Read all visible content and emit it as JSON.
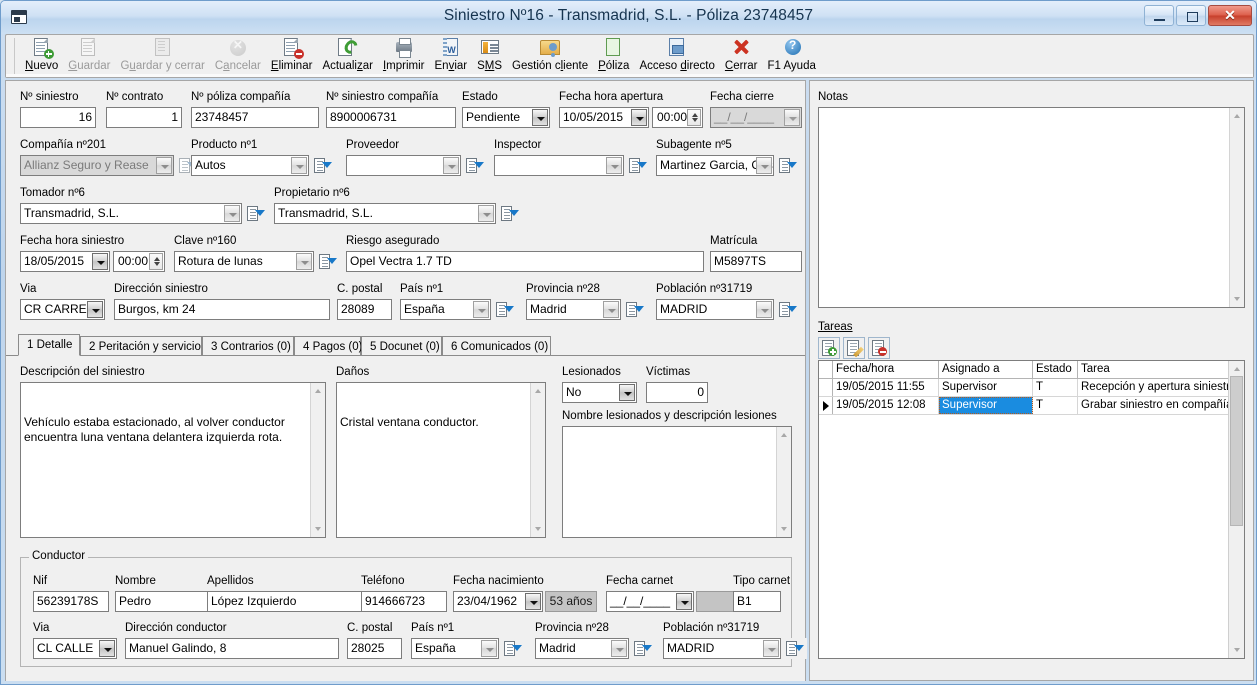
{
  "window": {
    "title": "Siniestro Nº16 - Transmadrid, S.L. - Póliza 23748457",
    "minimize_label": "",
    "maximize_label": "",
    "close_label": ""
  },
  "toolbar": [
    {
      "name": "nuevo",
      "label": "Nuevo",
      "icon": "new-document-icon",
      "disabled": false
    },
    {
      "name": "guardar",
      "label": "Guardar",
      "icon": "save-icon",
      "disabled": true
    },
    {
      "name": "guardar-cerrar",
      "label": "Guardar y cerrar",
      "icon": "save-and-close-icon",
      "disabled": true
    },
    {
      "name": "cancelar",
      "label": "Cancelar",
      "icon": "cancel-icon",
      "disabled": true
    },
    {
      "name": "eliminar",
      "label": "Eliminar",
      "icon": "delete-document-icon",
      "disabled": false
    },
    {
      "name": "actualizar",
      "label": "Actualizar",
      "icon": "refresh-icon",
      "disabled": false
    },
    {
      "name": "imprimir",
      "label": "Imprimir",
      "icon": "printer-icon",
      "disabled": false
    },
    {
      "name": "enviar",
      "label": "Enviar",
      "icon": "word-document-icon",
      "disabled": false
    },
    {
      "name": "sms",
      "label": "SMS",
      "icon": "sms-icon",
      "disabled": false
    },
    {
      "name": "gestion-cliente",
      "label": "Gestión cliente",
      "icon": "client-card-icon",
      "disabled": false
    },
    {
      "name": "poliza",
      "label": "Póliza",
      "icon": "policy-document-icon",
      "disabled": false
    },
    {
      "name": "acceso-directo",
      "label": "Acceso directo",
      "icon": "shortcut-icon",
      "disabled": false
    },
    {
      "name": "cerrar",
      "label": "Cerrar",
      "icon": "red-x-icon",
      "disabled": false
    },
    {
      "name": "ayuda",
      "label": "F1 Ayuda",
      "icon": "help-icon",
      "disabled": false
    }
  ],
  "form": {
    "n_siniestro": {
      "label": "Nº siniestro",
      "value": "16"
    },
    "n_contrato": {
      "label": "Nº contrato",
      "value": "1"
    },
    "n_poliza_compania": {
      "label": "Nº póliza compañía",
      "value": "23748457"
    },
    "n_siniestro_compania": {
      "label": "Nº siniestro compañía",
      "value": "8900006731"
    },
    "estado": {
      "label": "Estado",
      "value": "Pendiente"
    },
    "fecha_hora_apertura": {
      "label": "Fecha hora apertura",
      "value": "10/05/2015",
      "time": "00:00"
    },
    "fecha_cierre": {
      "label": "Fecha cierre",
      "value": "__/__/____"
    },
    "compania": {
      "label": "Compañía nº201",
      "value": "Allianz Seguro y Rease"
    },
    "producto": {
      "label": "Producto nº1",
      "value": "Autos"
    },
    "proveedor": {
      "label": "Proveedor",
      "value": ""
    },
    "inspector": {
      "label": "Inspector",
      "value": ""
    },
    "subagente": {
      "label": "Subagente nº5",
      "value": "Martinez Garcia, Cris"
    },
    "tomador": {
      "label": "Tomador nº6",
      "value": "Transmadrid, S.L."
    },
    "propietario": {
      "label": "Propietario nº6",
      "value": "Transmadrid, S.L."
    },
    "fecha_hora_siniestro": {
      "label": "Fecha hora siniestro",
      "value": "18/05/2015",
      "time": "00:00"
    },
    "clave": {
      "label": "Clave nº160",
      "value": "Rotura de lunas"
    },
    "riesgo_asegurado": {
      "label": "Riesgo asegurado",
      "value": "Opel Vectra 1.7 TD"
    },
    "matricula": {
      "label": "Matrícula",
      "value": "M5897TS"
    },
    "via": {
      "label": "Via",
      "value": "CR CARRE"
    },
    "direccion_siniestro": {
      "label": "Dirección siniestro",
      "value": "Burgos, km 24"
    },
    "c_postal": {
      "label": "C. postal",
      "value": "28089"
    },
    "pais": {
      "label": "País nº1",
      "value": "España"
    },
    "provincia": {
      "label": "Provincia nº28",
      "value": "Madrid"
    },
    "poblacion": {
      "label": "Población nº31719",
      "value": "MADRID"
    }
  },
  "tabs": [
    {
      "name": "detalle",
      "label": "1 Detalle",
      "active": true
    },
    {
      "name": "peritacion",
      "label": "2 Peritación y servicio",
      "active": false
    },
    {
      "name": "contrarios",
      "label": "3 Contrarios (0)",
      "active": false
    },
    {
      "name": "pagos",
      "label": "4 Pagos (0)",
      "active": false
    },
    {
      "name": "docunet",
      "label": "5 Docunet (0)",
      "active": false
    },
    {
      "name": "comunicados",
      "label": "6 Comunicados (0)",
      "active": false
    }
  ],
  "detalle": {
    "descripcion": {
      "label": "Descripción del siniestro",
      "value": "Vehículo estaba estacionado, al volver conductor encuentra luna ventana delantera izquierda rota."
    },
    "danos": {
      "label": "Daños",
      "value": "Cristal ventana conductor."
    },
    "lesionados": {
      "label": "Lesionados",
      "value": "No"
    },
    "victimas": {
      "label": "Víctimas",
      "value": "0"
    },
    "nombre_lesionados": {
      "label": "Nombre lesionados y descripción lesiones",
      "value": ""
    }
  },
  "conductor": {
    "title": "Conductor",
    "nif": {
      "label": "Nif",
      "value": "56239178S"
    },
    "nombre": {
      "label": "Nombre",
      "value": "Pedro"
    },
    "apellidos": {
      "label": "Apellidos",
      "value": "López Izquierdo"
    },
    "telefono": {
      "label": "Teléfono",
      "value": "914666723"
    },
    "fecha_nacimiento": {
      "label": "Fecha nacimiento",
      "value": "23/04/1962",
      "edad": "53 años"
    },
    "fecha_carnet": {
      "label": "Fecha carnet",
      "value": "__/__/____",
      "extra": ""
    },
    "tipo_carnet": {
      "label": "Tipo carnet",
      "value": "B1"
    },
    "via": {
      "label": "Via",
      "value": "CL CALLE"
    },
    "direccion": {
      "label": "Dirección conductor",
      "value": "Manuel Galindo, 8"
    },
    "c_postal": {
      "label": "C. postal",
      "value": "28025"
    },
    "pais": {
      "label": "País nº1",
      "value": "España"
    },
    "provincia": {
      "label": "Provincia nº28",
      "value": "Madrid"
    },
    "poblacion": {
      "label": "Población nº31719",
      "value": "MADRID"
    }
  },
  "notas": {
    "label": "Notas",
    "value": ""
  },
  "tareas": {
    "label": "Tareas",
    "buttons": [
      {
        "name": "nueva-tarea",
        "icon": "new-task-icon"
      },
      {
        "name": "editar-tarea",
        "icon": "edit-task-icon"
      },
      {
        "name": "eliminar-tarea",
        "icon": "delete-task-icon"
      }
    ],
    "columns": [
      "Fecha/hora",
      "Asignado a",
      "Estado",
      "Tarea"
    ],
    "rows": [
      {
        "current": false,
        "fecha": "19/05/2015 11:55",
        "asignado": "Supervisor",
        "estado": "T",
        "tarea": "Recepción y apertura siniestro",
        "selected": false
      },
      {
        "current": true,
        "fecha": "19/05/2015 12:08",
        "asignado": "Supervisor",
        "estado": "T",
        "tarea": "Grabar siniestro en compañía",
        "selected": true
      }
    ]
  },
  "colors": {
    "accent_blue": "#1a8ce0",
    "title_text": "#16344f",
    "panel_bg": "#f0f0f0",
    "close_red": "#c73f2b"
  }
}
